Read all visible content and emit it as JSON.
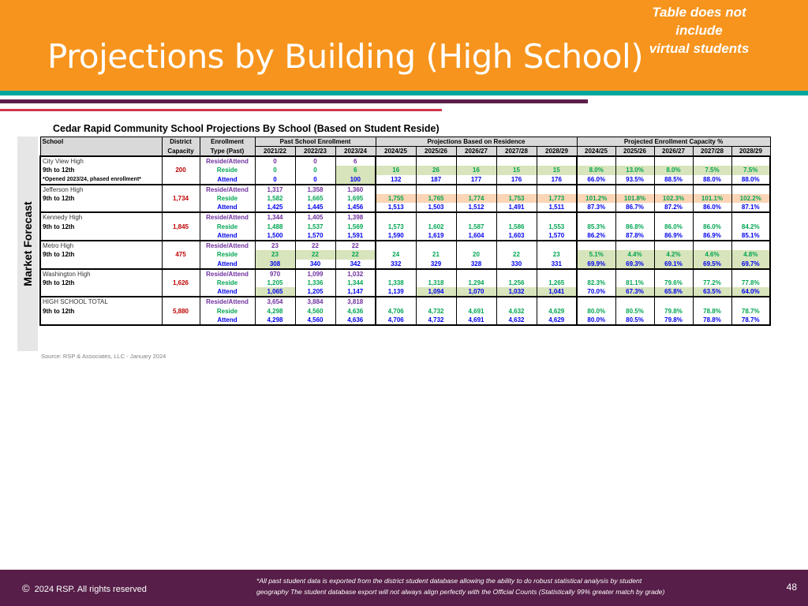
{
  "header": {
    "title": "Projections by Building (High School)",
    "note_line1": "Table does not include",
    "note_line2": "virtual students"
  },
  "side_label": "Market Forecast",
  "table": {
    "title": "Cedar Rapid Community School Projections By School (Based on Student Reside)",
    "headers": {
      "school": "School",
      "district": "District",
      "capacity": "Capacity",
      "enrollment": "Enrollment",
      "type_past": "Type (Past)",
      "past_group": "Past School Enrollment",
      "proj_group": "Projections Based on Residence",
      "cap_group": "Projected Enrollment Capacity %",
      "past_years": [
        "2021/22",
        "2022/23",
        "2023/24"
      ],
      "proj_years": [
        "2024/25",
        "2025/26",
        "2026/27",
        "2027/28",
        "2028/29"
      ],
      "cap_years": [
        "2024/25",
        "2025/26",
        "2026/27",
        "2027/28",
        "2028/29"
      ]
    },
    "type_labels": {
      "ra": "Reside/Attend",
      "r": "Reside",
      "a": "Attend"
    },
    "schools": [
      {
        "name": "City View High",
        "grades": "9th to 12th",
        "note": "*Opened 2023/24, phased enrollment*",
        "capacity": "200",
        "ra_past": [
          "0",
          "0",
          "6"
        ],
        "r_past": [
          "0",
          "0",
          "6"
        ],
        "a_past": [
          "0",
          "0",
          "100"
        ],
        "r_proj": [
          "16",
          "26",
          "16",
          "15",
          "15"
        ],
        "a_proj": [
          "132",
          "187",
          "177",
          "176",
          "176"
        ],
        "r_cap": [
          "8.0%",
          "13.0%",
          "8.0%",
          "7.5%",
          "7.5%"
        ],
        "a_cap": [
          "66.0%",
          "93.5%",
          "88.5%",
          "88.0%",
          "88.0%"
        ]
      },
      {
        "name": "Jefferson High",
        "grades": "9th to 12th",
        "note": "",
        "capacity": "1,734",
        "ra_past": [
          "1,317",
          "1,358",
          "1,360"
        ],
        "r_past": [
          "1,582",
          "1,665",
          "1,695"
        ],
        "a_past": [
          "1,425",
          "1,445",
          "1,456"
        ],
        "r_proj": [
          "1,755",
          "1,765",
          "1,774",
          "1,753",
          "1,773"
        ],
        "a_proj": [
          "1,513",
          "1,503",
          "1,512",
          "1,491",
          "1,511"
        ],
        "r_cap": [
          "101.2%",
          "101.8%",
          "102.3%",
          "101.1%",
          "102.2%"
        ],
        "a_cap": [
          "87.3%",
          "86.7%",
          "87.2%",
          "86.0%",
          "87.1%"
        ]
      },
      {
        "name": "Kennedy High",
        "grades": "9th to 12th",
        "note": "",
        "capacity": "1,845",
        "ra_past": [
          "1,344",
          "1,405",
          "1,398"
        ],
        "r_past": [
          "1,488",
          "1,537",
          "1,569"
        ],
        "a_past": [
          "1,500",
          "1,570",
          "1,591"
        ],
        "r_proj": [
          "1,573",
          "1,602",
          "1,587",
          "1,586",
          "1,553"
        ],
        "a_proj": [
          "1,590",
          "1,619",
          "1,604",
          "1,603",
          "1,570"
        ],
        "r_cap": [
          "85.3%",
          "86.8%",
          "86.0%",
          "86.0%",
          "84.2%"
        ],
        "a_cap": [
          "86.2%",
          "87.8%",
          "86.9%",
          "86.9%",
          "85.1%"
        ]
      },
      {
        "name": "Metro High",
        "grades": "9th to 12th",
        "note": "",
        "capacity": "475",
        "ra_past": [
          "23",
          "22",
          "22"
        ],
        "r_past": [
          "23",
          "22",
          "22"
        ],
        "a_past": [
          "308",
          "340",
          "342"
        ],
        "r_proj": [
          "24",
          "21",
          "20",
          "22",
          "23"
        ],
        "a_proj": [
          "332",
          "329",
          "328",
          "330",
          "331"
        ],
        "r_cap": [
          "5.1%",
          "4.4%",
          "4.2%",
          "4.6%",
          "4.8%"
        ],
        "a_cap": [
          "69.9%",
          "69.3%",
          "69.1%",
          "69.5%",
          "69.7%"
        ]
      },
      {
        "name": "Washington High",
        "grades": "9th to 12th",
        "note": "",
        "capacity": "1,626",
        "ra_past": [
          "970",
          "1,099",
          "1,032"
        ],
        "r_past": [
          "1,205",
          "1,336",
          "1,344"
        ],
        "a_past": [
          "1,065",
          "1,205",
          "1,147"
        ],
        "r_proj": [
          "1,338",
          "1,318",
          "1,294",
          "1,256",
          "1,265"
        ],
        "a_proj": [
          "1,139",
          "1,094",
          "1,070",
          "1,032",
          "1,041"
        ],
        "r_cap": [
          "82.3%",
          "81.1%",
          "79.6%",
          "77.2%",
          "77.8%"
        ],
        "a_cap": [
          "70.0%",
          "67.3%",
          "65.8%",
          "63.5%",
          "64.0%"
        ]
      },
      {
        "name": "HIGH SCHOOL TOTAL",
        "grades": "9th to 12th",
        "note": "",
        "capacity": "5,880",
        "ra_past": [
          "3,654",
          "3,884",
          "3,818"
        ],
        "r_past": [
          "4,298",
          "4,560",
          "4,636"
        ],
        "a_past": [
          "4,298",
          "4,560",
          "4,636"
        ],
        "r_proj": [
          "4,706",
          "4,732",
          "4,691",
          "4,632",
          "4,629"
        ],
        "a_proj": [
          "4,706",
          "4,732",
          "4,691",
          "4,632",
          "4,629"
        ],
        "r_cap": [
          "80.0%",
          "80.5%",
          "79.8%",
          "78.8%",
          "78.7%"
        ],
        "a_cap": [
          "80.0%",
          "80.5%",
          "79.8%",
          "78.8%",
          "78.7%"
        ]
      }
    ],
    "highlights": [
      {
        "school": 0,
        "row": "r",
        "cols": "past2,proj,cap",
        "color": "#d8e4bc"
      },
      {
        "school": 0,
        "row": "a",
        "cols": "past2",
        "color": "#d8e4bc"
      },
      {
        "school": 1,
        "row": "r",
        "cols": "proj,cap",
        "color": "#fbd5b5"
      },
      {
        "school": 3,
        "row": "r",
        "cols": "past,cap",
        "color": "#d8e4bc"
      },
      {
        "school": 3,
        "row": "a",
        "cols": "past0,cap",
        "color": "#d8e4bc"
      },
      {
        "school": 4,
        "row": "a",
        "cols": "past0,proj1-4,cap1-4",
        "color": "#d8e4bc"
      }
    ],
    "source": "Source:  RSP & Associates, LLC - January 2024"
  },
  "footer": {
    "copyright_symbol": "©",
    "copyright": "2024 RSP. All rights reserved",
    "disclaimer_line1": "*All past student data is exported from the district student database allowing the ability to do robust statistical analysis by student",
    "disclaimer_line2": "geography The student database export will not always align perfectly with the Official Counts (Statistically 99% greater match by grade)",
    "page_number": "48"
  },
  "colors": {
    "header": "#f7941d",
    "teal": "#00a79d",
    "purple": "#5a1f4a",
    "red": "#d2364a",
    "footer": "#561e48",
    "reside_attend": "#7030a0",
    "reside": "#00a651",
    "attend": "#0000ee",
    "capacity": "#c00000"
  }
}
